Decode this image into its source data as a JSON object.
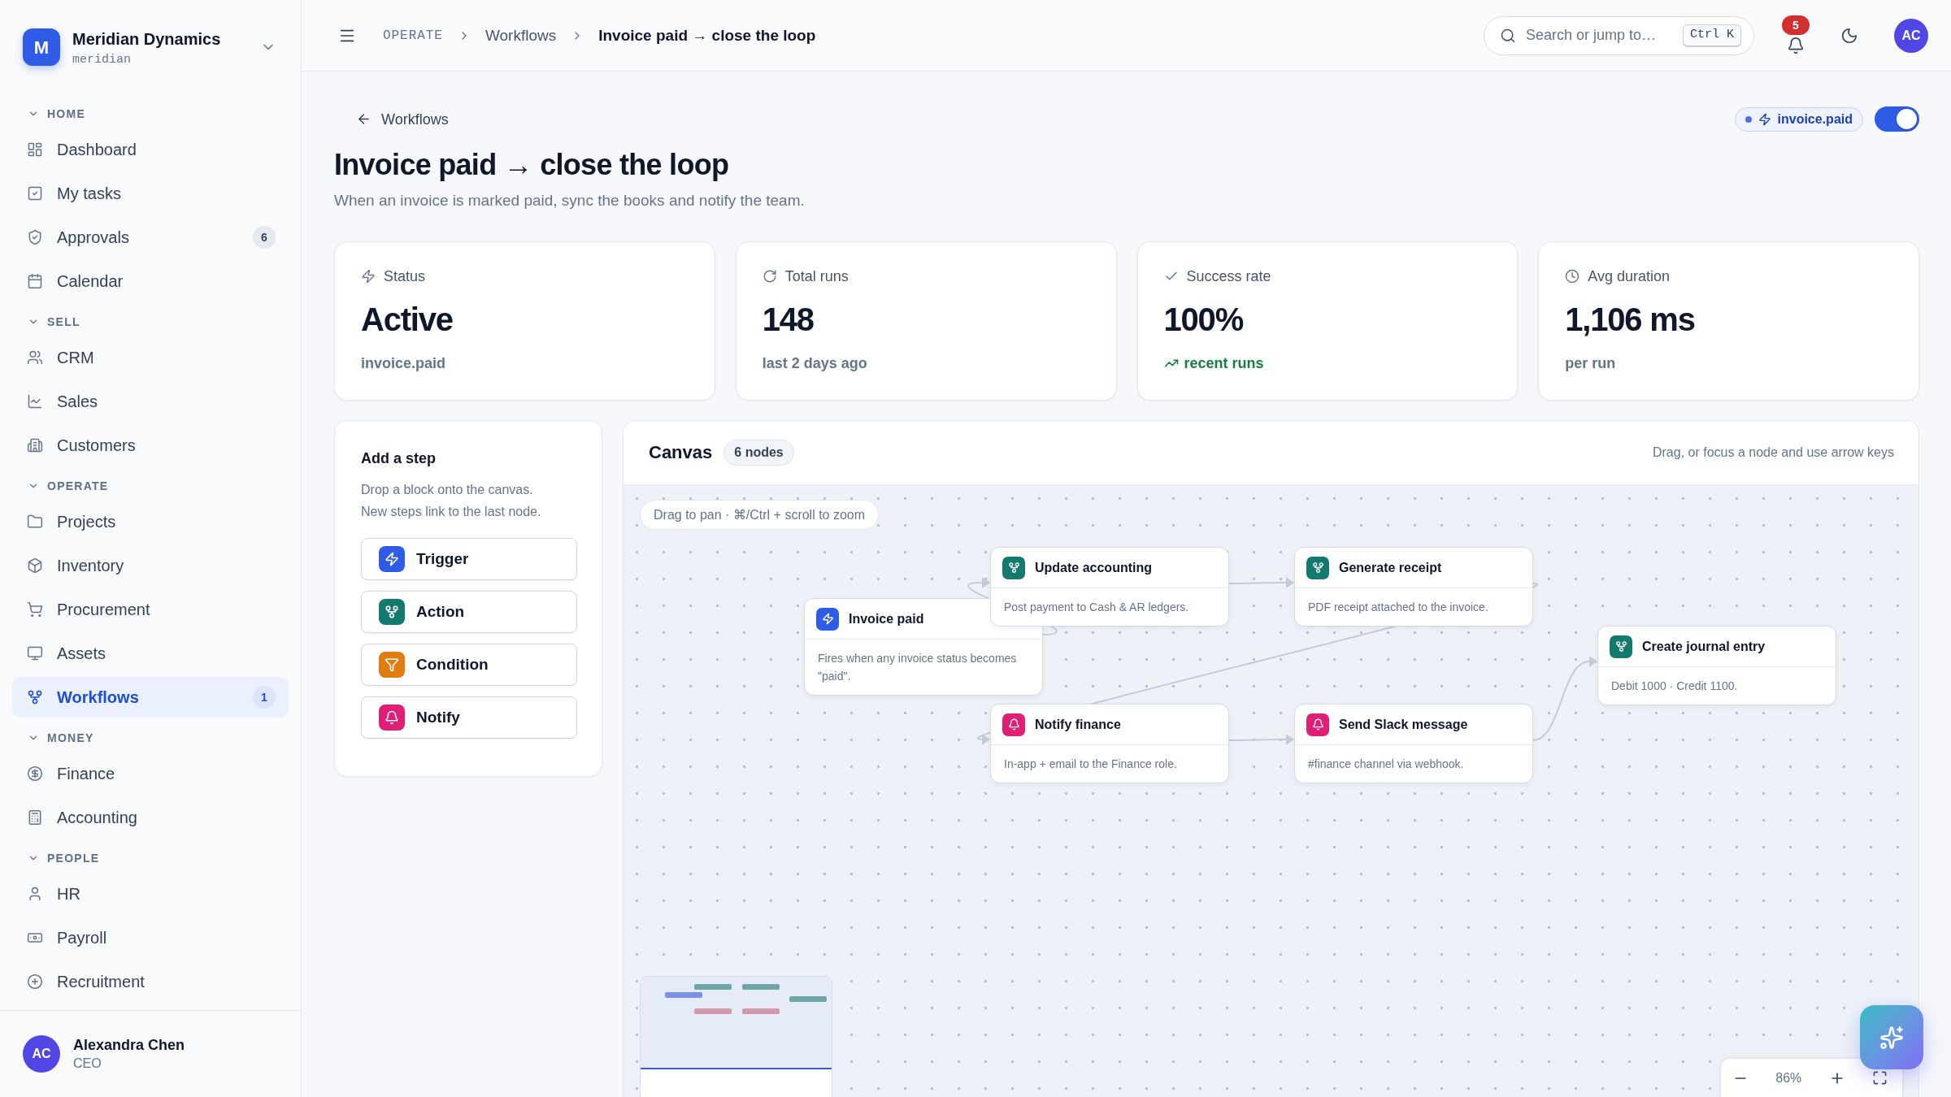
{
  "sidebar": {
    "workspace": {
      "initial": "M",
      "name": "Meridian Dynamics",
      "slug": "meridian"
    },
    "sections": [
      {
        "title": "HOME",
        "expanded": true,
        "items": [
          {
            "label": "Dashboard",
            "selected": false
          },
          {
            "label": "My tasks",
            "selected": false
          },
          {
            "label": "Approvals",
            "selected": false,
            "badge": "6"
          },
          {
            "label": "Calendar",
            "selected": false
          }
        ]
      },
      {
        "title": "SELL",
        "expanded": true,
        "items": [
          {
            "label": "CRM",
            "selected": false
          },
          {
            "label": "Sales",
            "selected": false
          },
          {
            "label": "Customers",
            "selected": false
          }
        ]
      },
      {
        "title": "OPERATE",
        "expanded": true,
        "items": [
          {
            "label": "Projects",
            "selected": false
          },
          {
            "label": "Inventory",
            "selected": false
          },
          {
            "label": "Procurement",
            "selected": false
          },
          {
            "label": "Assets",
            "selected": false
          },
          {
            "label": "Workflows",
            "selected": true,
            "badge": "1"
          }
        ]
      },
      {
        "title": "MONEY",
        "expanded": true,
        "items": [
          {
            "label": "Finance",
            "selected": false
          },
          {
            "label": "Accounting",
            "selected": false
          }
        ]
      },
      {
        "title": "PEOPLE",
        "expanded": true,
        "items": [
          {
            "label": "HR",
            "selected": false
          },
          {
            "label": "Payroll",
            "selected": false
          },
          {
            "label": "Recruitment",
            "selected": false
          }
        ]
      }
    ],
    "user": {
      "initials": "AC",
      "name": "Alexandra Chen",
      "role": "CEO"
    }
  },
  "topbar": {
    "breadcrumb": [
      {
        "label": "OPERATE",
        "kind": "section"
      },
      {
        "label": "Workflows",
        "kind": "link"
      },
      {
        "label": "Invoice paid → close the loop",
        "kind": "current"
      }
    ],
    "search": {
      "placeholder": "Search or jump to…",
      "shortcut": "Ctrl K"
    },
    "notification_count": "5",
    "avatar_initials": "AC"
  },
  "page": {
    "back_link": "Workflows",
    "title": "Invoice paid → close the loop",
    "description": "When an invoice is marked paid, sync the books and notify the team.",
    "trigger_event": "invoice.paid",
    "enabled": true,
    "stats": [
      {
        "kind": "status",
        "label": "Status",
        "value": "Active",
        "footnote": "invoice.paid",
        "trend_up": false
      },
      {
        "kind": "runs",
        "label": "Total runs",
        "value": "148",
        "footnote": "last 2 days ago",
        "trend_up": false
      },
      {
        "kind": "success",
        "label": "Success rate",
        "value": "100%",
        "footnote": "recent runs",
        "trend_up": true
      },
      {
        "kind": "duration",
        "label": "Avg duration",
        "value": "1,106 ms",
        "footnote": "per run",
        "trend_up": false
      }
    ]
  },
  "add_step": {
    "title": "Add a step",
    "description": "Drop a block onto the canvas. New steps link to the last node.",
    "blocks": [
      {
        "label": "Trigger",
        "kind": "trigger"
      },
      {
        "label": "Action",
        "kind": "action"
      },
      {
        "label": "Condition",
        "kind": "condition"
      },
      {
        "label": "Notify",
        "kind": "notify"
      }
    ]
  },
  "canvas": {
    "title": "Canvas",
    "node_count": "6 nodes",
    "hint": "Drag, or focus a node and use arrow keys",
    "pan_hint": "Drag to pan · ⌘/Ctrl + scroll to zoom",
    "nodes": [
      {
        "title": "Invoice paid",
        "description": "Fires when any invoice status becomes \"paid\".",
        "kind": "trigger",
        "linked_to_next": true
      },
      {
        "title": "Update accounting",
        "description": "Post payment to Cash & AR ledgers.",
        "kind": "action",
        "linked_to_next": true
      },
      {
        "title": "Generate receipt",
        "description": "PDF receipt attached to the invoice.",
        "kind": "action",
        "linked_to_next": true
      },
      {
        "title": "Notify finance",
        "description": "In-app + email to the Finance role.",
        "kind": "notify",
        "linked_to_next": true
      },
      {
        "title": "Send Slack message",
        "description": "#finance channel via webhook.",
        "kind": "notify",
        "linked_to_next": true
      },
      {
        "title": "Create journal entry",
        "description": "Debit 1000 · Credit 1100.",
        "kind": "action",
        "linked_to_next": false
      }
    ],
    "zoom_level": "86%"
  }
}
